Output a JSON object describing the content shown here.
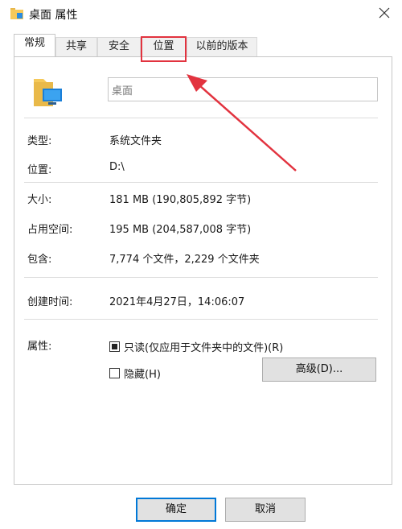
{
  "window": {
    "title": "桌面 属性"
  },
  "tabs": [
    {
      "label": "常规"
    },
    {
      "label": "共享"
    },
    {
      "label": "安全"
    },
    {
      "label": "位置"
    },
    {
      "label": "以前的版本"
    }
  ],
  "general": {
    "name_value": "桌面",
    "type_label": "类型:",
    "type_value": "系统文件夹",
    "location_label": "位置:",
    "location_value": "D:\\",
    "size_label": "大小:",
    "size_value": "181 MB (190,805,892 字节)",
    "disk_size_label": "占用空间:",
    "disk_size_value": "195 MB (204,587,008 字节)",
    "contains_label": "包含:",
    "contains_value": "7,774 个文件，2,229 个文件夹",
    "created_label": "创建时间:",
    "created_value": "2021年4月27日，14:06:07",
    "attributes_label": "属性:",
    "readonly_label": "只读(仅应用于文件夹中的文件)(R)",
    "readonly_checked": true,
    "hidden_label": "隐藏(H)",
    "hidden_checked": false,
    "advanced_label": "高级(D)..."
  },
  "footer": {
    "ok_label": "确定",
    "cancel_label": "取消"
  },
  "annotation": {
    "highlight_color": "#e2333f"
  }
}
